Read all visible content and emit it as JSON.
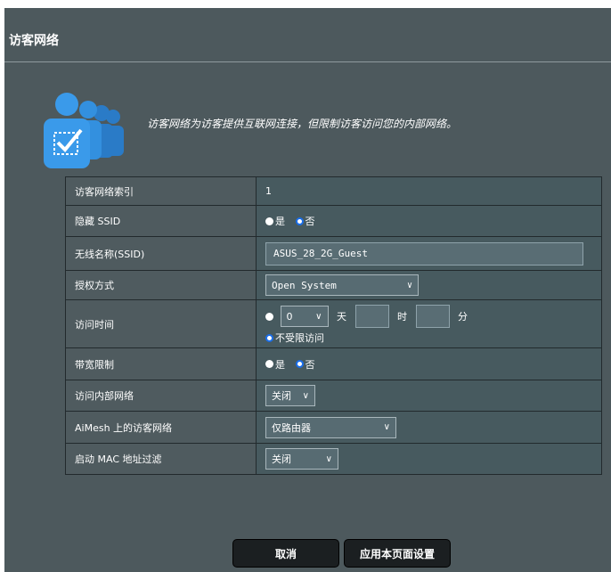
{
  "page": {
    "title": "访客网络"
  },
  "intro": {
    "description": "访客网络为访客提供互联网连接，但限制访客访问您的内部网络。"
  },
  "rows": {
    "index": {
      "label": "访客网络索引",
      "value": "1"
    },
    "hide_ssid": {
      "label": "隐藏 SSID",
      "opt_yes": "是",
      "opt_no": "否",
      "selected": "否"
    },
    "ssid": {
      "label": "无线名称(SSID)",
      "value": "ASUS_28_2G_Guest"
    },
    "auth": {
      "label": "授权方式",
      "value": "Open System"
    },
    "access_time": {
      "label": "访问时间",
      "days": "0",
      "unit_day": "天",
      "unit_hour": "时",
      "unit_min": "分",
      "unlimited": "不受限访问",
      "selected": "不受限访问"
    },
    "bandwidth": {
      "label": "带宽限制",
      "opt_yes": "是",
      "opt_no": "否",
      "selected": "否"
    },
    "intranet": {
      "label": "访问内部网络",
      "value": "关闭"
    },
    "aimesh": {
      "label": "AiMesh 上的访客网络",
      "value": "仅路由器"
    },
    "mac_filter": {
      "label": "启动 MAC 地址过滤",
      "value": "关闭"
    }
  },
  "buttons": {
    "cancel": "取消",
    "apply": "应用本页面设置"
  },
  "colors": {
    "panel": "#4d595d",
    "accent_blue": "#1a6eea",
    "icon_blue": "#2f8ad8"
  }
}
